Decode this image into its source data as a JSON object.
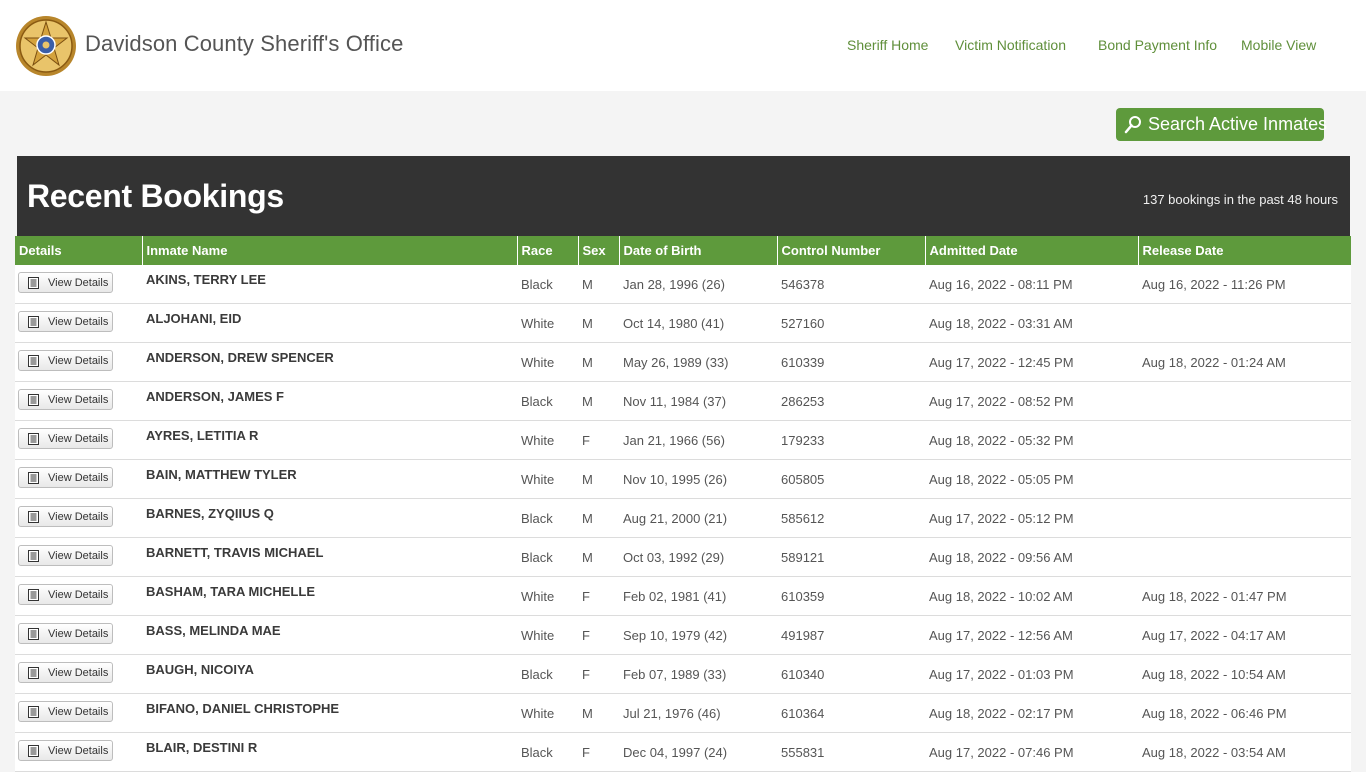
{
  "header": {
    "site_title": "Davidson County Sheriff's Office",
    "badge_icon": "sheriff-star-badge-icon",
    "nav": [
      {
        "label": "Sheriff Home"
      },
      {
        "label": "Victim Notification"
      },
      {
        "label": "Bond Payment Info"
      },
      {
        "label": "Mobile View"
      }
    ]
  },
  "search": {
    "label": "Search Active Inmates",
    "icon": "magnifier-icon",
    "color": "#5e9a3c"
  },
  "banner": {
    "title": "Recent Bookings",
    "count_text": "137 bookings in the past 48 hours"
  },
  "table": {
    "columns": [
      "Details",
      "Inmate Name",
      "Race",
      "Sex",
      "Date of Birth",
      "Control Number",
      "Admitted Date",
      "Release Date"
    ],
    "button_label": "View Details",
    "rows": [
      {
        "name": "AKINS, TERRY  LEE",
        "race": "Black",
        "sex": "M",
        "dob": "Jan 28, 1996 (26)",
        "control": "546378",
        "admitted": "Aug 16, 2022 - 08:11 PM",
        "release": "Aug 16, 2022 - 11:26 PM"
      },
      {
        "name": "ALJOHANI, EID",
        "race": "White",
        "sex": "M",
        "dob": "Oct 14, 1980 (41)",
        "control": "527160",
        "admitted": "Aug 18, 2022 - 03:31 AM",
        "release": ""
      },
      {
        "name": "ANDERSON, DREW  SPENCER",
        "race": "White",
        "sex": "M",
        "dob": "May 26, 1989 (33)",
        "control": "610339",
        "admitted": "Aug 17, 2022 - 12:45 PM",
        "release": "Aug 18, 2022 - 01:24 AM"
      },
      {
        "name": "ANDERSON, JAMES  F",
        "race": "Black",
        "sex": "M",
        "dob": "Nov 11, 1984 (37)",
        "control": "286253",
        "admitted": "Aug 17, 2022 - 08:52 PM",
        "release": ""
      },
      {
        "name": "AYRES, LETITIA  R",
        "race": "White",
        "sex": "F",
        "dob": "Jan 21, 1966 (56)",
        "control": "179233",
        "admitted": "Aug 18, 2022 - 05:32 PM",
        "release": ""
      },
      {
        "name": "BAIN, MATTHEW  TYLER",
        "race": "White",
        "sex": "M",
        "dob": "Nov 10, 1995 (26)",
        "control": "605805",
        "admitted": "Aug 18, 2022 - 05:05 PM",
        "release": ""
      },
      {
        "name": "BARNES, ZYQIIUS  Q",
        "race": "Black",
        "sex": "M",
        "dob": "Aug 21, 2000 (21)",
        "control": "585612",
        "admitted": "Aug 17, 2022 - 05:12 PM",
        "release": ""
      },
      {
        "name": "BARNETT, TRAVIS  MICHAEL",
        "race": "Black",
        "sex": "M",
        "dob": "Oct 03, 1992 (29)",
        "control": "589121",
        "admitted": "Aug 18, 2022 - 09:56 AM",
        "release": ""
      },
      {
        "name": "BASHAM, TARA  MICHELLE",
        "race": "White",
        "sex": "F",
        "dob": "Feb 02, 1981 (41)",
        "control": "610359",
        "admitted": "Aug 18, 2022 - 10:02 AM",
        "release": "Aug 18, 2022 - 01:47 PM"
      },
      {
        "name": "BASS, MELINDA  MAE",
        "race": "White",
        "sex": "F",
        "dob": "Sep 10, 1979 (42)",
        "control": "491987",
        "admitted": "Aug 17, 2022 - 12:56 AM",
        "release": "Aug 17, 2022 - 04:17 AM"
      },
      {
        "name": "BAUGH, NICOIYA",
        "race": "Black",
        "sex": "F",
        "dob": "Feb 07, 1989 (33)",
        "control": "610340",
        "admitted": "Aug 17, 2022 - 01:03 PM",
        "release": "Aug 18, 2022 - 10:54 AM"
      },
      {
        "name": "BIFANO, DANIEL  CHRISTOPHE",
        "race": "White",
        "sex": "M",
        "dob": "Jul 21, 1976 (46)",
        "control": "610364",
        "admitted": "Aug 18, 2022 - 02:17 PM",
        "release": "Aug 18, 2022 - 06:46 PM"
      },
      {
        "name": "BLAIR, DESTINI  R",
        "race": "Black",
        "sex": "F",
        "dob": "Dec 04, 1997 (24)",
        "control": "555831",
        "admitted": "Aug 17, 2022 - 07:46 PM",
        "release": "Aug 18, 2022 - 03:54 AM"
      }
    ]
  }
}
